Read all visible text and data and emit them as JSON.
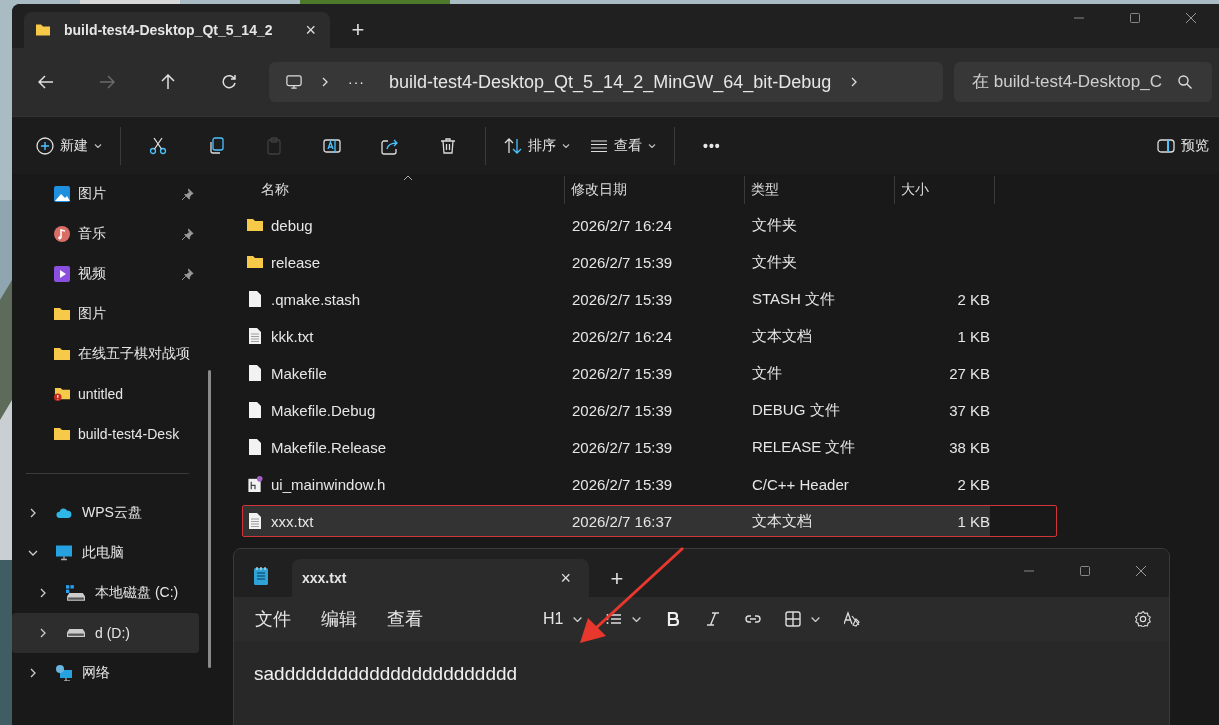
{
  "explorer": {
    "tab": {
      "title": "build-test4-Desktop_Qt_5_14_2",
      "close": "×"
    },
    "new_tab": "+",
    "nav": [
      {
        "kind": "back",
        "disabled": false
      },
      {
        "kind": "forward",
        "disabled": true
      },
      {
        "kind": "up",
        "disabled": false
      },
      {
        "kind": "refresh",
        "disabled": false
      }
    ],
    "address": {
      "overflow": "···",
      "path": "build-test4-Desktop_Qt_5_14_2_MinGW_64_bit-Debug"
    },
    "search": {
      "placeholder": "在 build-test4-Desktop_C"
    },
    "toolbar": [
      {
        "kind": "new",
        "label": "新建",
        "disabled": false
      },
      {
        "kind": "cut",
        "disabled": false
      },
      {
        "kind": "copy",
        "disabled": false
      },
      {
        "kind": "paste",
        "disabled": true
      },
      {
        "kind": "rename",
        "disabled": false
      },
      {
        "kind": "share",
        "disabled": false
      },
      {
        "kind": "delete",
        "disabled": false
      },
      {
        "kind": "sort",
        "label": "排序",
        "disabled": false
      },
      {
        "kind": "view",
        "label": "查看",
        "disabled": false
      },
      {
        "kind": "more",
        "label": "•••",
        "disabled": false
      }
    ],
    "preview": {
      "label": "预览"
    },
    "quick_access": [
      {
        "kind": "pictures",
        "label": "图片",
        "pinned": true
      },
      {
        "kind": "music",
        "label": "音乐",
        "pinned": true
      },
      {
        "kind": "videos",
        "label": "视频",
        "pinned": true
      },
      {
        "kind": "folder",
        "label": "图片",
        "pinned": false
      },
      {
        "kind": "folder",
        "label": "在线五子棋对战项",
        "pinned": false
      },
      {
        "kind": "folder-error",
        "label": "untitled",
        "pinned": false
      },
      {
        "kind": "folder",
        "label": "build-test4-Desk",
        "pinned": false
      }
    ],
    "tree": [
      {
        "kind": "cloud",
        "label": "WPS云盘",
        "expanded": false,
        "selected": false
      },
      {
        "kind": "pc",
        "label": "此电脑",
        "expanded": true,
        "selected": false,
        "children": [
          {
            "kind": "system-drive",
            "label": "本地磁盘 (C:)",
            "expanded": false,
            "selected": false
          },
          {
            "kind": "drive",
            "label": "d (D:)",
            "expanded": false,
            "selected": true
          }
        ]
      },
      {
        "kind": "network",
        "label": "网络",
        "expanded": false,
        "selected": false
      }
    ],
    "table": {
      "columns": [
        {
          "label": "名称",
          "sorted": true
        },
        {
          "label": "修改日期",
          "sorted": false
        },
        {
          "label": "类型",
          "sorted": false
        },
        {
          "label": "大小",
          "sorted": false
        }
      ],
      "rows": [
        {
          "kind": "folder",
          "name": "debug",
          "date": "2026/2/7 16:24",
          "type": "文件夹",
          "selected": false,
          "outlined": false
        },
        {
          "kind": "folder",
          "name": "release",
          "date": "2026/2/7 15:39",
          "type": "文件夹",
          "selected": false,
          "outlined": false
        },
        {
          "kind": "file",
          "name": ".qmake.stash",
          "date": "2026/2/7 15:39",
          "type": "STASH 文件",
          "size": "2 KB",
          "selected": false,
          "outlined": false
        },
        {
          "kind": "text",
          "name": "kkk.txt",
          "date": "2026/2/7 16:24",
          "type": "文本文档",
          "size": "1 KB",
          "selected": false,
          "outlined": false
        },
        {
          "kind": "file",
          "name": "Makefile",
          "date": "2026/2/7 15:39",
          "type": "文件",
          "size": "27 KB",
          "selected": false,
          "outlined": false
        },
        {
          "kind": "file",
          "name": "Makefile.Debug",
          "date": "2026/2/7 15:39",
          "type": "DEBUG 文件",
          "size": "37 KB",
          "selected": false,
          "outlined": false
        },
        {
          "kind": "file",
          "name": "Makefile.Release",
          "date": "2026/2/7 15:39",
          "type": "RELEASE 文件",
          "size": "38 KB",
          "selected": false,
          "outlined": false
        },
        {
          "kind": "header",
          "name": "ui_mainwindow.h",
          "date": "2026/2/7 15:39",
          "type": "C/C++ Header",
          "size": "2 KB",
          "selected": false,
          "outlined": false
        },
        {
          "kind": "text",
          "name": "xxx.txt",
          "date": "2026/2/7 16:37",
          "type": "文本文档",
          "size": "1 KB",
          "selected": true,
          "outlined": true
        }
      ]
    }
  },
  "notepad": {
    "tab": {
      "title": "xxx.txt",
      "close": "×"
    },
    "new_tab": "+",
    "menu": [
      "文件",
      "编辑",
      "查看"
    ],
    "format_tools": [
      {
        "kind": "heading",
        "label": "H1",
        "dropdown": true
      },
      {
        "kind": "list",
        "dropdown": true
      },
      {
        "kind": "bold",
        "dropdown": false
      },
      {
        "kind": "italic",
        "dropdown": false
      },
      {
        "kind": "link",
        "dropdown": false
      },
      {
        "kind": "table",
        "dropdown": true
      },
      {
        "kind": "clear",
        "dropdown": false
      }
    ],
    "content": "saddddddddddddddddddddddd"
  },
  "annotation_arrow": true
}
